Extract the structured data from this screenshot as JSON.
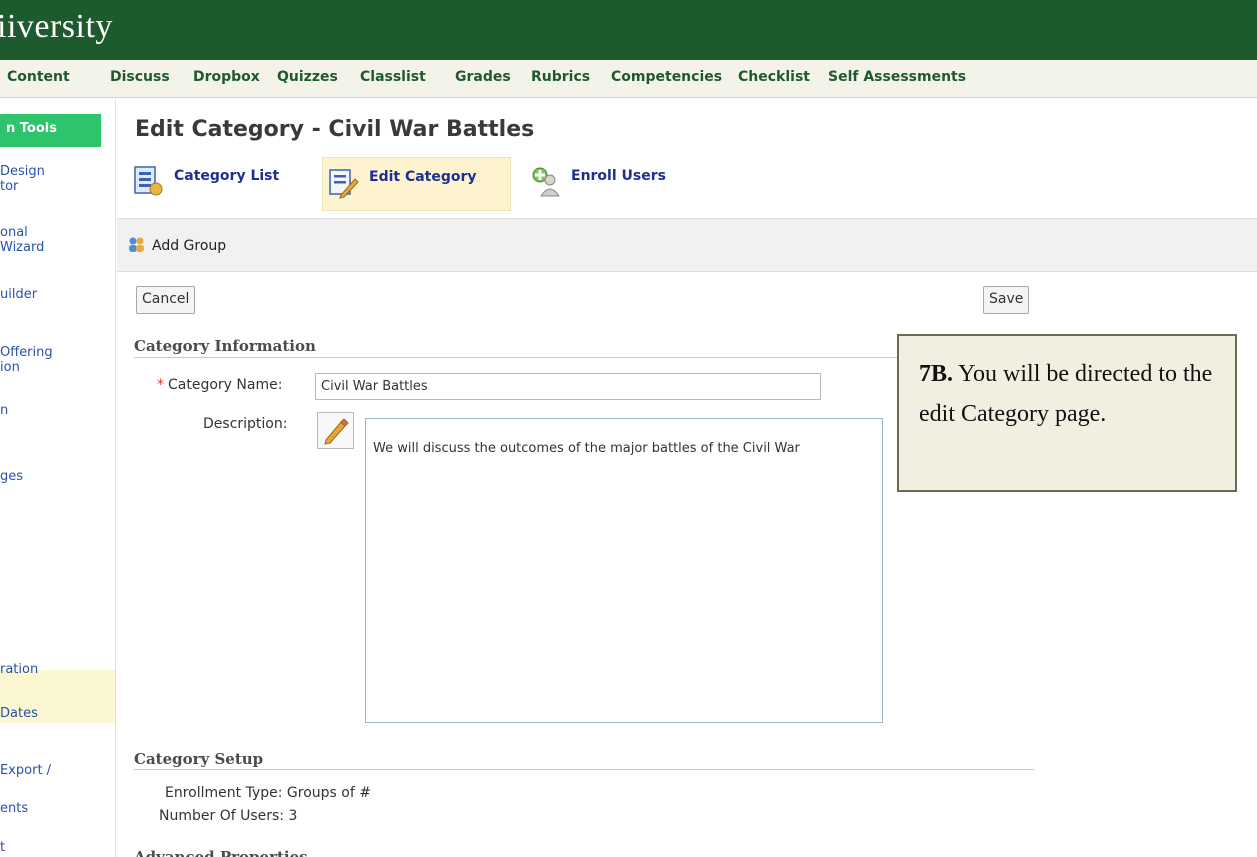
{
  "banner": {
    "title": "iiversity"
  },
  "nav": {
    "items": [
      "Content",
      "Discuss",
      "Dropbox",
      "Quizzes",
      "Classlist",
      "Grades",
      "Rubrics",
      "Competencies",
      "Checklist",
      "Self Assessments"
    ]
  },
  "sidebar": {
    "header": "n Tools",
    "items": [
      {
        "line1": "Design",
        "line2": "tor"
      },
      {
        "line1": "onal",
        "line2": "Wizard"
      },
      {
        "line1": "uilder",
        "line2": ""
      },
      {
        "line1": "Offering",
        "line2": "ion"
      },
      {
        "line1": "n",
        "line2": ""
      },
      {
        "line1": "ges",
        "line2": ""
      },
      {
        "line1": "ration",
        "line2": ""
      },
      {
        "line1": "Dates",
        "line2": ""
      },
      {
        "line1": "Export /",
        "line2": ""
      },
      {
        "line1": "ents",
        "line2": ""
      },
      {
        "line1": "t",
        "line2": ""
      }
    ]
  },
  "page": {
    "title": "Edit Category - Civil War Battles"
  },
  "tabs": [
    {
      "label": "Category List",
      "icon": "category-list-icon"
    },
    {
      "label": "Edit Category",
      "icon": "edit-category-icon"
    },
    {
      "label": "Enroll Users",
      "icon": "enroll-users-icon"
    }
  ],
  "toolbar": {
    "add_group_label": "Add Group"
  },
  "buttons": {
    "cancel": "Cancel",
    "save": "Save"
  },
  "category_info": {
    "section_title": "Category Information",
    "name_label": "Category Name:",
    "name_value": "Civil War Battles",
    "description_label": "Description:",
    "description_value": "We will discuss the outcomes of the major battles of the Civil War"
  },
  "category_setup": {
    "section_title": "Category Setup",
    "enrollment_type_label": "Enrollment Type:",
    "enrollment_type_value": "Groups of #",
    "number_of_users_label": "Number Of Users:",
    "number_of_users_value": "3"
  },
  "advanced": {
    "section_title": "Advanced Properties"
  },
  "callout": {
    "step": "7B.",
    "text": "You will be directed to the edit Category page."
  },
  "colors": {
    "banner": "#1d5b2f",
    "nav_text": "#1f5a2c",
    "sidebar_header": "#2ec46c",
    "link_blue": "#1e2f94",
    "active_tab": "#fdf4cf"
  }
}
